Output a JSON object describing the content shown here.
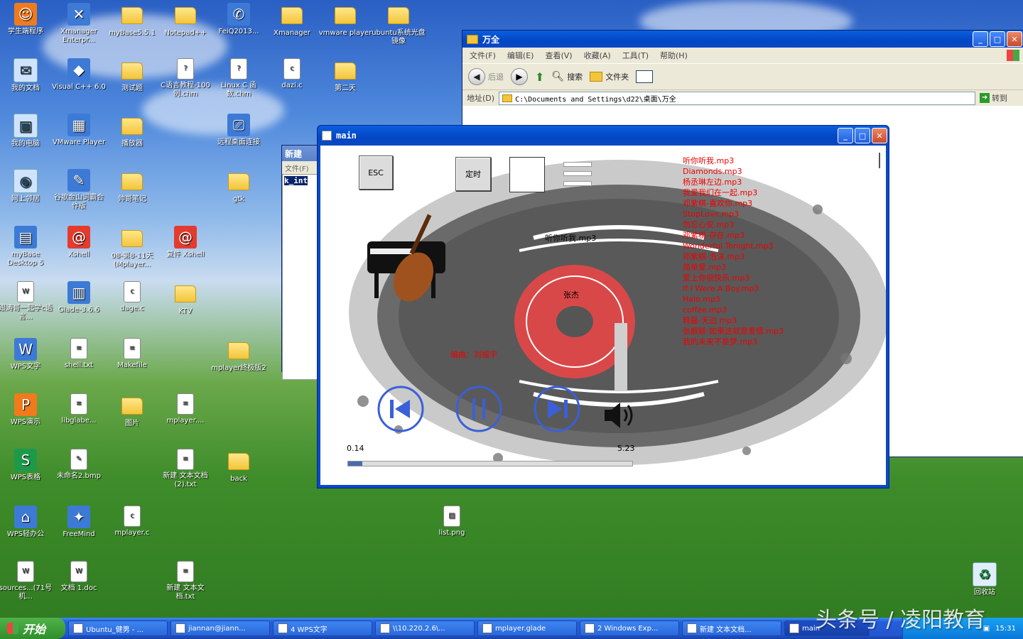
{
  "desktop": {
    "icons": [
      {
        "label": "学生端程序",
        "icon": "student-app-icon"
      },
      {
        "label": "Xmanager Enterpr...",
        "icon": "xmanager-icon"
      },
      {
        "label": "myBase5.5.1",
        "icon": "folder-icon"
      },
      {
        "label": "Notepad++",
        "icon": "folder-icon"
      },
      {
        "label": "FeiQ2013...",
        "icon": "feiq-icon"
      },
      {
        "label": "Xmanager",
        "icon": "folder-icon"
      },
      {
        "label": "vmware player",
        "icon": "folder-icon"
      },
      {
        "label": "ubuntu系统光盘镜像",
        "icon": "folder-icon"
      },
      {
        "label": "我的文档",
        "icon": "documents-icon"
      },
      {
        "label": "Visual C++ 6.0",
        "icon": "vc-icon"
      },
      {
        "label": "测试题",
        "icon": "folder-icon"
      },
      {
        "label": "C语言教程-100例.chm",
        "icon": "chm-icon"
      },
      {
        "label": "Linux C 函数.chm",
        "icon": "chm-icon"
      },
      {
        "label": "dazi.c",
        "icon": "c-file-icon"
      },
      {
        "label": "第二天",
        "icon": "folder-icon"
      },
      {
        "label": "我的电脑",
        "icon": "computer-icon"
      },
      {
        "label": "VMware Player",
        "icon": "vmware-icon"
      },
      {
        "label": "播放器",
        "icon": "folder-icon"
      },
      {
        "label": "远程桌面连接",
        "icon": "remote-desktop-icon"
      },
      {
        "label": "网上邻居",
        "icon": "network-icon"
      },
      {
        "label": "谷歌金山词霸合作版",
        "icon": "dictionary-icon"
      },
      {
        "label": "帅哥笔记",
        "icon": "folder-icon"
      },
      {
        "label": "gtk",
        "icon": "folder-icon"
      },
      {
        "label": "myBase Desktop 5",
        "icon": "mybase-icon"
      },
      {
        "label": "Xshell",
        "icon": "xshell-icon"
      },
      {
        "label": "08-第8-11天(Mplayer...",
        "icon": "folder-icon"
      },
      {
        "label": "复件 Xshell",
        "icon": "xshell-icon"
      },
      {
        "label": "跟涛哥一起学c语言...",
        "icon": "word-doc-icon"
      },
      {
        "label": "Glade-3.6.6",
        "icon": "glade-icon"
      },
      {
        "label": "dage.c",
        "icon": "c-file-icon"
      },
      {
        "label": "KTV",
        "icon": "folder-icon"
      },
      {
        "label": "WPS文字",
        "icon": "wps-writer-icon"
      },
      {
        "label": "shell.txt",
        "icon": "text-file-icon"
      },
      {
        "label": "Makefile",
        "icon": "makefile-icon"
      },
      {
        "label": "mplayer终极版2",
        "icon": "folder-icon"
      },
      {
        "label": "WPS演示",
        "icon": "wps-presentation-icon"
      },
      {
        "label": "libglabe...",
        "icon": "file-icon"
      },
      {
        "label": "图片",
        "icon": "folder-icon"
      },
      {
        "label": "mplayer....",
        "icon": "file-icon"
      },
      {
        "label": "WPS表格",
        "icon": "wps-spreadsheet-icon"
      },
      {
        "label": "未命名2.bmp",
        "icon": "bitmap-icon"
      },
      {
        "label": "新建 文本文档 (2).txt",
        "icon": "text-file-icon"
      },
      {
        "label": "back",
        "icon": "folder-icon"
      },
      {
        "label": "WPS轻办公",
        "icon": "wps-office-icon"
      },
      {
        "label": "FreeMind",
        "icon": "freemind-icon"
      },
      {
        "label": "mplayer.c",
        "icon": "c-file-icon"
      },
      {
        "label": "list.png",
        "icon": "image-file-icon"
      },
      {
        "label": "sources...(71号机...",
        "icon": "word-doc-icon"
      },
      {
        "label": "文档 1.doc",
        "icon": "word-doc-icon"
      },
      {
        "label": "新建 文本文档.txt",
        "icon": "text-file-icon"
      },
      {
        "label": "回收站",
        "icon": "recycle-bin-icon"
      }
    ]
  },
  "explorer": {
    "title": "万全",
    "menu": [
      "文件(F)",
      "编辑(E)",
      "查看(V)",
      "收藏(A)",
      "工具(T)",
      "帮助(H)"
    ],
    "toolbar": {
      "back": "后退",
      "search": "搜索",
      "folders": "文件夹"
    },
    "address_label": "地址(D)",
    "address": "C:\\Documents and Settings\\d22\\桌面\\万全",
    "go": "转到"
  },
  "behind_window": {
    "title": "新建",
    "menu": "文件(F)",
    "code": "k_int"
  },
  "player": {
    "title": "main",
    "esc_label": "ESC",
    "timer_label": "定时",
    "song_title": "听你听我.mp3",
    "artist": "张杰",
    "credit": "编曲：刘福宇",
    "time_current": "0.14",
    "time_total": "5.23",
    "progress": 0.05,
    "volume": 0.5,
    "playlist": [
      "听你听我.mp3",
      "Diamonds.mp3",
      "杨丞琳左边.mp3",
      "我爱我们在一起.mp3",
      "邓紫棋-喜欢你.mp3",
      "StopLove.mp3",
      "勿忘心安.mp3",
      "邓紫棋-存在.mp3",
      "Wonderful Tonight.mp3",
      "邓紫棋-泡沫.mp3",
      "简单爱.mp3",
      "爱上你很快乐.mp3",
      "If I Were A Boy.mp3",
      "Halo.mp3",
      "coffee.mp3",
      "韩磊-天边.mp3",
      "张靓颖-如果这就是爱情.mp3",
      "我的未来不是梦.mp3"
    ],
    "colors": {
      "playlist": "#e00000",
      "controls": "#3a5fd8",
      "credit": "#e00000"
    }
  },
  "taskbar": {
    "start": "开始",
    "tasks": [
      {
        "label": "Ubuntu_健男 - ...",
        "active": false
      },
      {
        "label": "jiannan@jiann...",
        "active": false
      },
      {
        "label": "4 WPS文字",
        "active": false
      },
      {
        "label": "\\\\10.220.2.6\\...",
        "active": false
      },
      {
        "label": "mplayer.glade",
        "active": false
      },
      {
        "label": "2 Windows Exp...",
        "active": false
      },
      {
        "label": "新建 文本文档...",
        "active": false
      },
      {
        "label": "main",
        "active": true
      }
    ],
    "clock": "15:31"
  },
  "watermark": "头条号 / 凌阳教育"
}
